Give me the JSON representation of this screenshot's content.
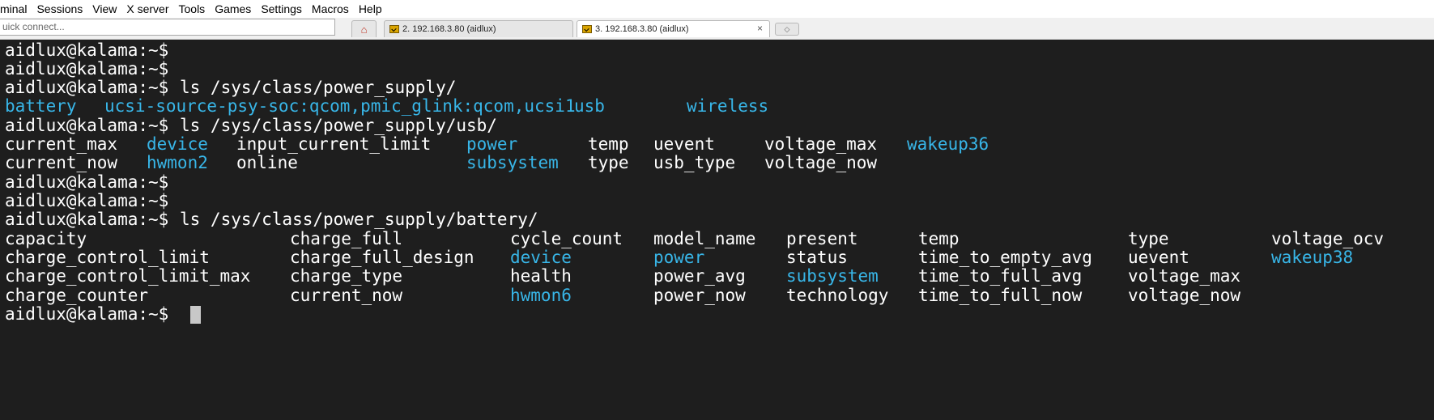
{
  "menubar": [
    "minal",
    "Sessions",
    "View",
    "X server",
    "Tools",
    "Games",
    "Settings",
    "Macros",
    "Help"
  ],
  "toolbar": {
    "quick_connect_placeholder": "uick connect...",
    "tabs": [
      {
        "label": "2. 192.168.3.80 (aidlux)"
      },
      {
        "label": "3. 192.168.3.80 (aidlux)",
        "close": "×"
      }
    ],
    "new_tab_glyph": "◇"
  },
  "terminal": {
    "prompt": "aidlux@kalama:~$",
    "cmd_power_supply": "ls /sys/class/power_supply/",
    "cmd_usb": "ls /sys/class/power_supply/usb/",
    "cmd_battery": "ls /sys/class/power_supply/battery/",
    "power_supply_entries": [
      "battery",
      "ucsi-source-psy-soc:qcom,pmic_glink:qcom,ucsi1",
      "usb",
      "wireless"
    ],
    "usb_rows": [
      [
        "current_max",
        "device",
        "input_current_limit",
        "power",
        "temp",
        "uevent",
        "voltage_max",
        "wakeup36"
      ],
      [
        "current_now",
        "hwmon2",
        "online",
        "subsystem",
        "type",
        "usb_type",
        "voltage_now"
      ]
    ],
    "battery_rows": [
      [
        "capacity",
        "charge_full",
        "cycle_count",
        "model_name",
        "present",
        "temp",
        "type",
        "voltage_ocv"
      ],
      [
        "charge_control_limit",
        "charge_full_design",
        "device",
        "power",
        "status",
        "time_to_empty_avg",
        "uevent",
        "wakeup38"
      ],
      [
        "charge_control_limit_max",
        "charge_type",
        "health",
        "power_avg",
        "subsystem",
        "time_to_full_avg",
        "voltage_max"
      ],
      [
        "charge_counter",
        "current_now",
        "hwmon6",
        "power_now",
        "technology",
        "time_to_full_now",
        "voltage_now"
      ]
    ],
    "colors": {
      "background": "#1e1e1e",
      "text": "#ffffff",
      "directory": "#38b6e8",
      "cursor": "#c8c8c8"
    }
  }
}
